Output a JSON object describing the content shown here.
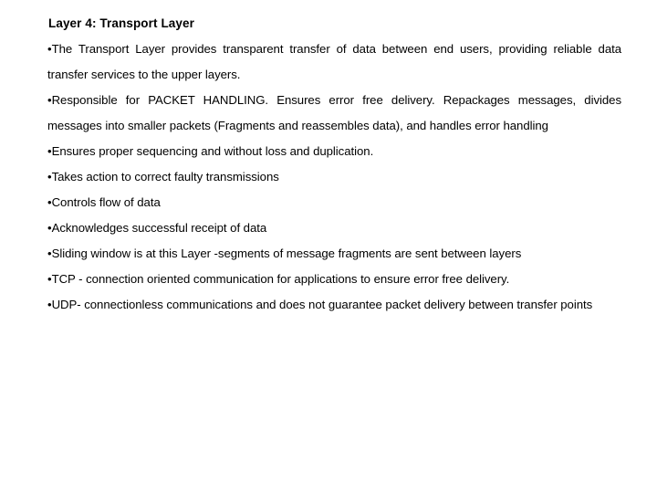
{
  "slide": {
    "title": "Layer 4: Transport Layer",
    "bullet_char": "•",
    "text_color": "#000000",
    "background_color": "#ffffff",
    "bullets": [
      "The Transport Layer provides transparent transfer of data between end users, providing reliable data transfer services to the upper layers.",
      "Responsible for PACKET HANDLING. Ensures error free delivery. Repackages messages, divides messages into smaller packets (Fragments and reassembles data), and handles error handling",
      "Ensures proper sequencing and without loss and duplication.",
      "Takes action to correct faulty transmissions",
      "Controls flow of data",
      "Acknowledges successful receipt of data",
      "Sliding window is at this Layer -segments of message fragments are sent between layers",
      "TCP - connection oriented communication for applications to ensure error free delivery.",
      "UDP- connectionless communications and does not guarantee packet delivery between transfer points"
    ]
  }
}
